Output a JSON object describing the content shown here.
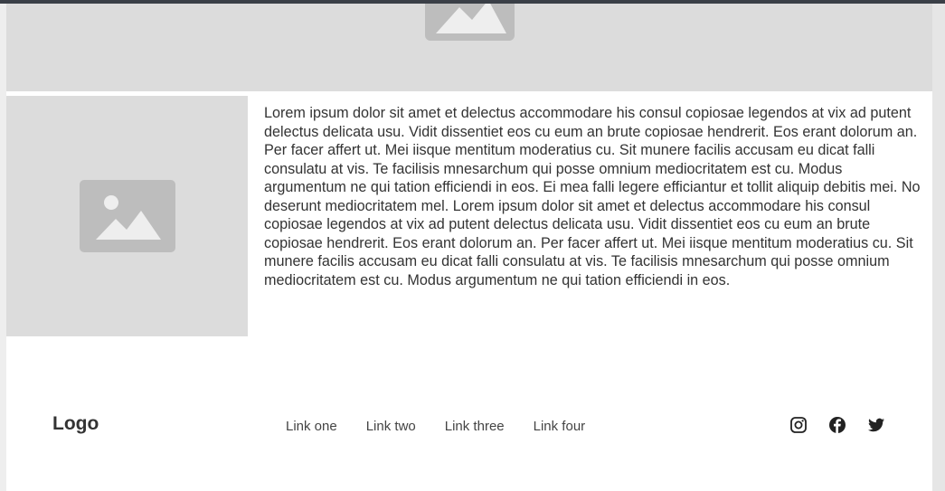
{
  "hero": {
    "image_icon": "image-placeholder-icon"
  },
  "content": {
    "image_icon": "image-placeholder-icon",
    "paragraph": "Lorem ipsum dolor sit amet et delectus accommodare his consul copiosae legendos at vix ad putent delectus delicata usu. Vidit dissentiet eos cu eum an brute copiosae hendrerit. Eos erant dolorum an. Per facer affert ut. Mei iisque mentitum moderatius cu. Sit munere facilis accusam eu dicat falli consulatu at vis. Te facilisis mnesarchum qui posse omnium mediocritatem est cu. Modus argumentum ne qui tation efficiendi in eos. Ei mea falli legere efficiantur et tollit aliquip debitis mei. No deserunt mediocritatem mel. Lorem ipsum dolor sit amet et delectus accommodare his consul copiosae legendos at vix ad putent delectus delicata usu. Vidit dissentiet eos cu eum an brute copiosae hendrerit. Eos erant dolorum an. Per facer affert ut. Mei iisque mentitum moderatius cu. Sit munere facilis accusam eu dicat falli consulatu at vis. Te facilisis mnesarchum qui posse omnium mediocritatem est cu. Modus argumentum ne qui tation efficiendi in eos."
  },
  "footer": {
    "logo": "Logo",
    "links": [
      "Link one",
      "Link two",
      "Link three",
      "Link four"
    ],
    "social_icons": [
      "instagram-icon",
      "facebook-icon",
      "twitter-icon"
    ]
  },
  "colors": {
    "placeholder_bg": "#dcdcdc",
    "placeholder_icon": "#bdbdbd",
    "text": "#333333",
    "topbar": "#3a3f47"
  }
}
